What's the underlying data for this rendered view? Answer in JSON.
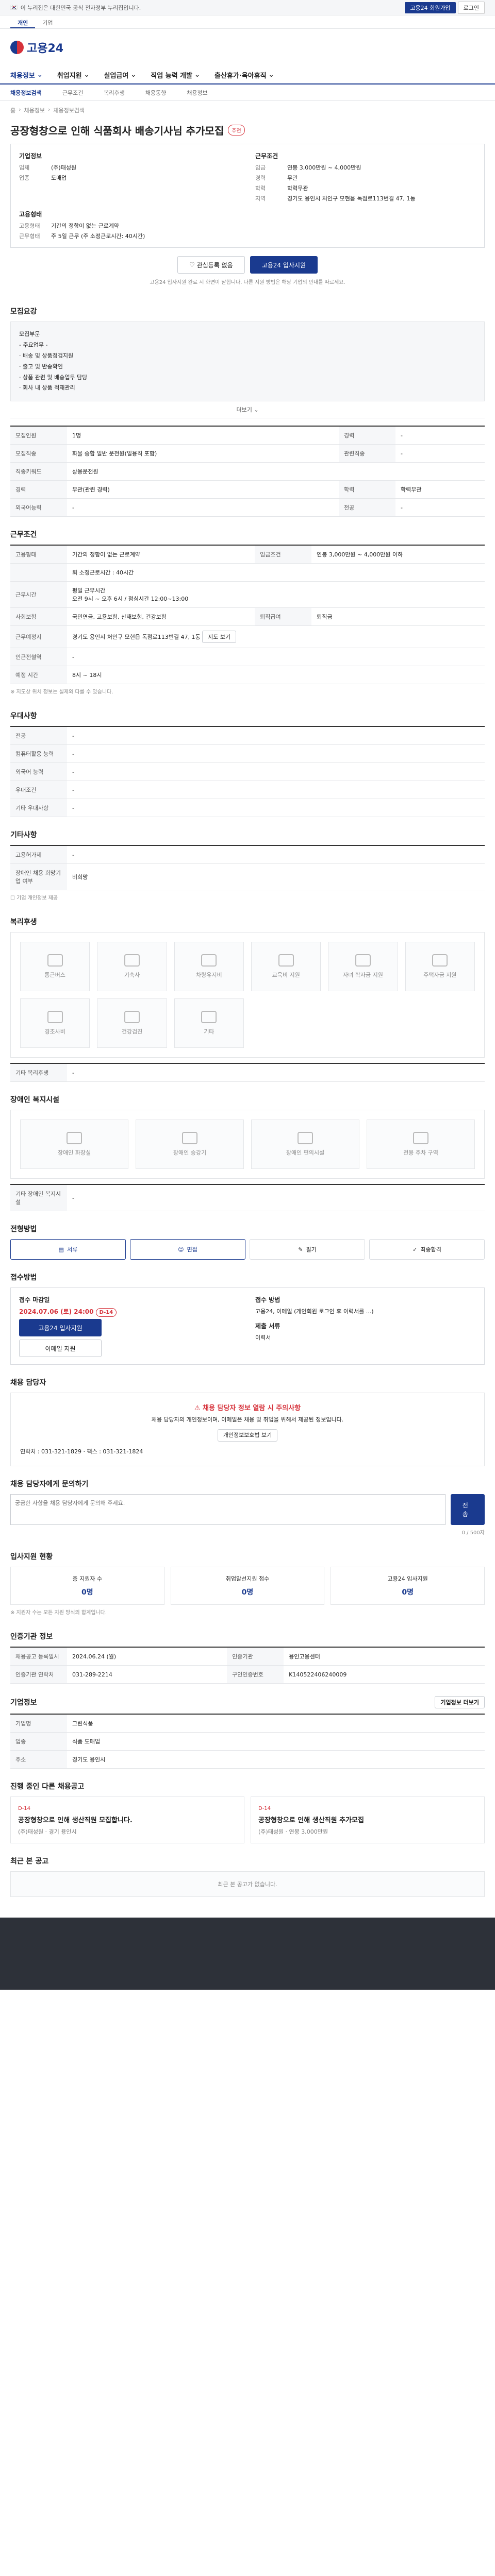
{
  "topbar": {
    "notice": "이 누리집은 대한민국 공식 전자정부 누리집입니다.",
    "btn_primary": "고용24 회원가입",
    "btn_light": "로그인"
  },
  "tabs": [
    "개인",
    "기업"
  ],
  "logo": "고용24",
  "gnb": [
    "채용정보",
    "취업지원",
    "실업급여",
    "직업 능력 개발",
    "출산휴가·육아휴직"
  ],
  "subnav": [
    "채용정보검색",
    "근무조건",
    "복리후생",
    "채용동향",
    "채용정보"
  ],
  "crumb": [
    "홈",
    "채용정보",
    "채용정보검색"
  ],
  "job": {
    "title": "공장형창으로 인해 식품회사 배송기사님 추가모집",
    "badge": "추천",
    "company_h": "기업정보",
    "company": [
      [
        "업체",
        "(주)태성원"
      ],
      [
        "업종",
        "도매업"
      ]
    ],
    "cond_h": "근무조건",
    "cond": [
      [
        "임금",
        "연봉 3,000만원 ~ 4,000만원"
      ],
      [
        "경력",
        "무관"
      ],
      [
        "학력",
        "학력무관"
      ],
      [
        "지역",
        "경기도 용인시 처인구 모현읍 독점로113번길 47, 1동"
      ]
    ],
    "hire_h": "고용형태",
    "hire": [
      [
        "고용형태",
        "기간의 정함이 없는 근로계약"
      ],
      [
        "근무형태",
        "주 5일 근무 (주 소정근로시간: 40시간)"
      ]
    ]
  },
  "apply": {
    "btn1": "관심등록 없음",
    "btn2": "고용24 입사지원",
    "note": "고용24 입사지원 완료 시 화면이 닫힙니다. 다른 지원 방법은 해당 기업의 안내를 따르세요."
  },
  "duty": {
    "title": "모집요강",
    "lines": [
      "모집부문",
      "- 주요업무 -",
      "· 배송 및 상품점검지원",
      "· 출고 및 반송확인",
      "· 상품 관련 및 배송업무 담당",
      "· 회사 내 상품 적재관리"
    ],
    "more": "더보기"
  },
  "recruit_tbl": [
    [
      "모집인원",
      "1명",
      "경력",
      "-"
    ],
    [
      "모집직종",
      "화물 승합 일반 운전원(일용직 포함)",
      "관련직종",
      "-"
    ],
    [
      "직종키워드",
      "상용운전원",
      "",
      ""
    ],
    [
      "경력",
      "무관(관련 경력)",
      "학력",
      "학력무관"
    ],
    [
      "외국어능력",
      "-",
      "전공",
      "-"
    ]
  ],
  "work": {
    "title": "근무조건",
    "rows": [
      [
        "고용형태",
        "기간의 정함이 없는 근로계약",
        "임금조건",
        "연봉 3,000만원 ~ 4,000만원 이하"
      ],
      [
        "",
        "퇴 소정근로시간 : 40시간",
        "",
        ""
      ],
      [
        "근무시간",
        "평일 근무시간\n오전 9시 ~ 오후 6시 / 점심시간 12:00~13:00",
        "",
        ""
      ],
      [
        "사회보험",
        "국민연금, 고용보험, 산재보험, 건강보험",
        "퇴직급여",
        "퇴직금"
      ],
      [
        "근무예정지",
        "경기도 용인시 처인구 모현읍 독점로113번길 47, 1동",
        "",
        ""
      ],
      [
        "인근전철역",
        "-",
        "",
        ""
      ],
      [
        "예정 시간",
        "8시 ~ 18시",
        "",
        ""
      ]
    ],
    "note": "※ 지도상 위치 정보는 실제와 다를 수 있습니다."
  },
  "pref": {
    "title": "우대사항",
    "rows": [
      [
        "전공",
        "-"
      ],
      [
        "컴퓨터활용 능력",
        "-"
      ],
      [
        "외국어 능력",
        "-"
      ],
      [
        "우대조건",
        "-"
      ],
      [
        "기타 우대사항",
        "-"
      ]
    ]
  },
  "etc": {
    "title": "기타사항",
    "rows": [
      [
        "고용허가제",
        "-"
      ],
      [
        "장애인 채용 희망기업 여부",
        "비희망"
      ]
    ],
    "note": "기업 개인정보 제공"
  },
  "welfare": {
    "title": "복리후생",
    "items": [
      "통근버스",
      "기숙사",
      "차량유지비",
      "교육비 지원",
      "자녀 학자금 지원",
      "주택자금 지원",
      "경조사비",
      "건강검진",
      "기타"
    ],
    "other": "기타 복리후생",
    "other_v": "-"
  },
  "disability": {
    "title": "장애인 복지시설",
    "items": [
      "장애인 화장실",
      "장애인 승강기",
      "장애인 편의시설",
      "전용 주차 구역"
    ],
    "other": "기타 장애인 복지시설",
    "other_v": "-"
  },
  "process": {
    "title": "전형방법",
    "steps": [
      "서류",
      "면접",
      "필기",
      "최종합격"
    ]
  },
  "accept": {
    "title": "접수방법",
    "h1": "접수 마감일",
    "deadline": "2024.07.06 (토) 24:00",
    "d_badge": "D-14",
    "h2": "접수 방법",
    "method": "고용24, 이메일 (개인회원 로그인 후 이력서를 ...)",
    "h3": "제출 서류",
    "docs": "이력서",
    "btn1": "고용24 입사지원",
    "btn2": "이메일 지원"
  },
  "contact": {
    "title": "채용 담당자",
    "warn": "채용 담당자 정보 열람 시 주의사항",
    "desc": "채용 담당자의 개인정보이며, 이메일은 채용 및 취업을 위해서 제공된 정보입니다.",
    "btn": "개인정보보호법 보기",
    "phone": "연락처 : 031-321-1829   ·  팩스 : 031-321-1824"
  },
  "inquiry": {
    "title": "채용 담당자에게 문의하기",
    "placeholder": "궁금한 사항을 채용 담당자에게 문의해 주세요.",
    "btn": "전송",
    "counter": "0 / 500자"
  },
  "apply_stats": {
    "title": "입사지원 현황",
    "items": [
      [
        "총 지원자 수",
        "0명"
      ],
      [
        "취업알선지원 접수",
        "0명"
      ],
      [
        "고용24 입사지원",
        "0명"
      ]
    ],
    "note": "※ 지원자 수는 모든 지원 방식의 합계입니다."
  },
  "managed": {
    "title": "인증기관 정보",
    "rows": [
      [
        "채용공고 등록일시",
        "2024.06.24 (월)",
        "인증기관",
        "용인고용센터"
      ],
      [
        "인증기관 연락처",
        "031-289-2214",
        "구인인증번호",
        "K140522406240009"
      ]
    ]
  },
  "cinfo": {
    "title": "기업정보",
    "btn": "기업정보 더보기",
    "rows": [
      [
        "기업명",
        "그린식품"
      ],
      [
        "업종",
        "식품 도매업"
      ],
      [
        "주소",
        "경기도 용인시"
      ]
    ]
  },
  "similar": {
    "title": "진행 중인 다른 채용공고",
    "items": [
      [
        "D-14",
        "공장형창으로 인해 생산직원 모집합니다.",
        "(주)태성원 · 경기 용인시"
      ],
      [
        "D-14",
        "공장형창으로 인해 생산직원 추가모집",
        "(주)태성원 · 연봉 3,000만원"
      ]
    ]
  },
  "recent": {
    "title": "최근 본 공고",
    "nodata": "최근 본 공고가 없습니다."
  }
}
